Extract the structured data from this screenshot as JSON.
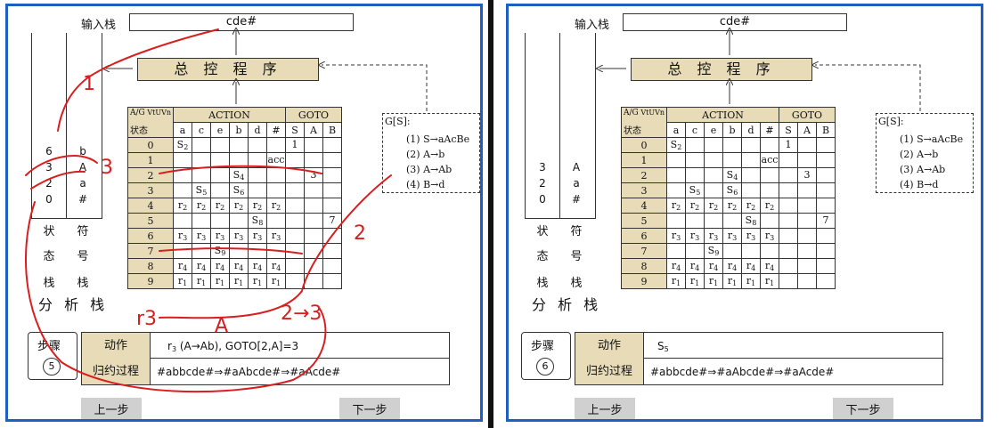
{
  "common": {
    "input_stack_label": "输入栈",
    "input_value": "cde#",
    "control_label": "总 控 程 序",
    "state_stack_label": [
      "状",
      "态",
      "栈"
    ],
    "symbol_stack_label": [
      "符",
      "号",
      "栈"
    ],
    "analysis_stack_label": "分 析 栈",
    "step_label": "步骤",
    "action_label": "动作",
    "reduction_label": "归约过程",
    "prev_button": "上一步",
    "next_button": "下一步",
    "table_corner_top": "A/G",
    "table_corner_vt": "VtUVn",
    "table_corner_state": "状态",
    "action_header": "ACTION",
    "goto_header": "GOTO",
    "terminals": [
      "a",
      "c",
      "e",
      "b",
      "d",
      "#"
    ],
    "nonterminals": [
      "S",
      "A",
      "B"
    ],
    "grammar_title": "G[S]:",
    "grammar_rules": [
      "(1) S→aAcBe",
      "(2) A→b",
      "(3) A→Ab",
      "(4) B→d"
    ],
    "table_rows": [
      {
        "state": "0",
        "cells": [
          [
            "S",
            "2"
          ],
          "",
          "",
          "",
          "",
          "",
          [
            "1",
            ""
          ],
          "",
          ""
        ]
      },
      {
        "state": "1",
        "cells": [
          "",
          "",
          "",
          "",
          "",
          [
            "acc",
            ""
          ],
          "",
          "",
          ""
        ]
      },
      {
        "state": "2",
        "cells": [
          "",
          "",
          "",
          [
            "S",
            "4"
          ],
          "",
          "",
          "",
          [
            "3",
            ""
          ],
          ""
        ]
      },
      {
        "state": "3",
        "cells": [
          "",
          [
            "S",
            "5"
          ],
          "",
          [
            "S",
            "6"
          ],
          "",
          "",
          "",
          "",
          ""
        ]
      },
      {
        "state": "4",
        "cells": [
          [
            "r",
            "2"
          ],
          [
            "r",
            "2"
          ],
          [
            "r",
            "2"
          ],
          [
            "r",
            "2"
          ],
          [
            "r",
            "2"
          ],
          [
            "r",
            "2"
          ],
          "",
          "",
          ""
        ]
      },
      {
        "state": "5",
        "cells": [
          "",
          "",
          "",
          "",
          [
            "S",
            "8"
          ],
          "",
          "",
          "",
          [
            "7",
            ""
          ]
        ]
      },
      {
        "state": "6",
        "cells": [
          [
            "r",
            "3"
          ],
          [
            "r",
            "3"
          ],
          [
            "r",
            "3"
          ],
          [
            "r",
            "3"
          ],
          [
            "r",
            "3"
          ],
          [
            "r",
            "3"
          ],
          "",
          "",
          ""
        ]
      },
      {
        "state": "7",
        "cells": [
          "",
          "",
          [
            "S",
            "9"
          ],
          "",
          "",
          "",
          "",
          "",
          ""
        ]
      },
      {
        "state": "8",
        "cells": [
          [
            "r",
            "4"
          ],
          [
            "r",
            "4"
          ],
          [
            "r",
            "4"
          ],
          [
            "r",
            "4"
          ],
          [
            "r",
            "4"
          ],
          [
            "r",
            "4"
          ],
          "",
          "",
          ""
        ]
      },
      {
        "state": "9",
        "cells": [
          [
            "r",
            "1"
          ],
          [
            "r",
            "1"
          ],
          [
            "r",
            "1"
          ],
          [
            "r",
            "1"
          ],
          [
            "r",
            "1"
          ],
          [
            "r",
            "1"
          ],
          "",
          "",
          ""
        ]
      }
    ]
  },
  "left": {
    "step_number": "5",
    "states": [
      "6",
      "3",
      "2",
      "0"
    ],
    "symbols": [
      "b",
      "A",
      "a",
      "#"
    ],
    "action_text": "r3 (A→Ab), GOTO[2,A]=3",
    "action_main": "r",
    "action_sub": "3",
    "action_rest": " (A→Ab), GOTO[2,A]=3",
    "reduction_text": "#abbcde#⇒#aAbcde#⇒#aAcde#",
    "annotations": [
      "1",
      "3",
      "2",
      "r3",
      "A",
      "2→3"
    ],
    "ink_color": "#d81e1e"
  },
  "right": {
    "step_number": "6",
    "states": [
      "3",
      "2",
      "0"
    ],
    "symbols": [
      "A",
      "a",
      "#"
    ],
    "action_main": "S",
    "action_sub": "5",
    "action_rest": "",
    "reduction_text": "#abbcde#⇒#aAbcde#⇒#aAcde#"
  },
  "colors": {
    "accent": "#e8dcb8",
    "frame": "#1f5fbf",
    "button": "#d0d0d0"
  }
}
